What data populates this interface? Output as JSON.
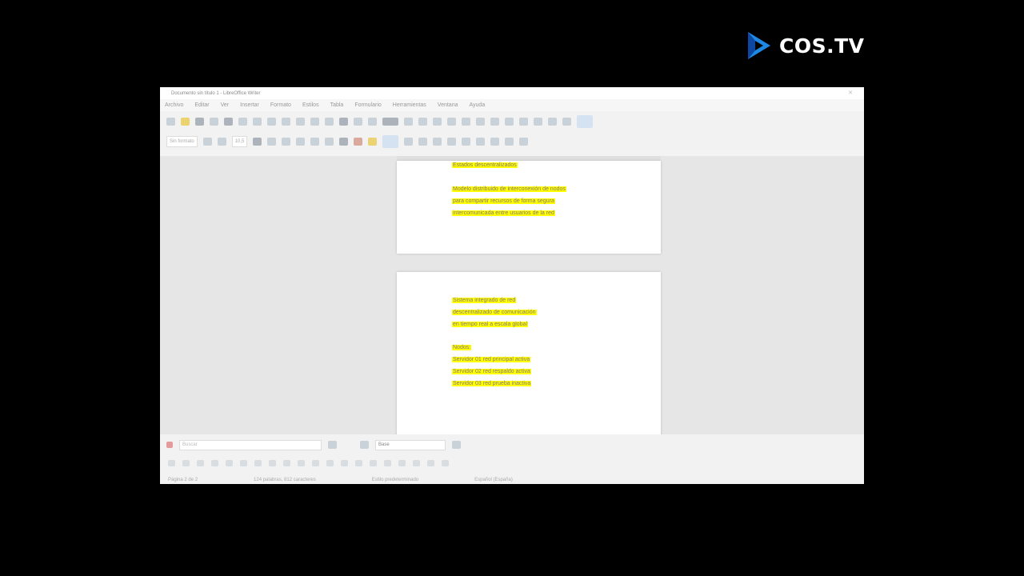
{
  "logo": {
    "text": "COS.TV",
    "accent": "#1e88e5"
  },
  "window": {
    "title": "Documento sin título 1 - LibreOffice Writer",
    "menu": [
      "Archivo",
      "Editar",
      "Ver",
      "Insertar",
      "Formato",
      "Estilos",
      "Tabla",
      "Formulario",
      "Herramientas",
      "Ventana",
      "Ayuda"
    ],
    "paragraph_style": "Sin formato",
    "font_size": "10,5",
    "find_placeholder": "Buscar",
    "style_combo": "Base",
    "highlight_color": "#ffff00"
  },
  "page1": {
    "lines": [
      {
        "text": "Estados descentralizados",
        "highlight": true
      },
      {
        "text": "",
        "highlight": false
      },
      {
        "text": "Modelo distribuido de interconexión de nodos",
        "highlight": true
      },
      {
        "text": "para compartir recursos de forma segura",
        "highlight": true
      },
      {
        "text": "intercomunicada entre usuarios de la red",
        "highlight": true
      }
    ]
  },
  "page2": {
    "lines": [
      {
        "text": "Sistema integrado de red",
        "highlight": true
      },
      {
        "text": "descentralizado de comunicación",
        "highlight": true
      },
      {
        "text": "en tiempo real a escala global",
        "highlight": true
      },
      {
        "text": "",
        "highlight": false
      },
      {
        "text": "Nodos:",
        "highlight": true
      },
      {
        "text": "Servidor 01 red principal activa",
        "highlight": true
      },
      {
        "text": "Servidor 02 red respaldo activa",
        "highlight": true
      },
      {
        "text": "Servidor 03 red prueba inactiva",
        "highlight": true
      }
    ]
  },
  "status": [
    "Página 2 de 2",
    "124 palabras, 812 caracteres",
    "Estilo predeterminado",
    "Español (España)"
  ]
}
